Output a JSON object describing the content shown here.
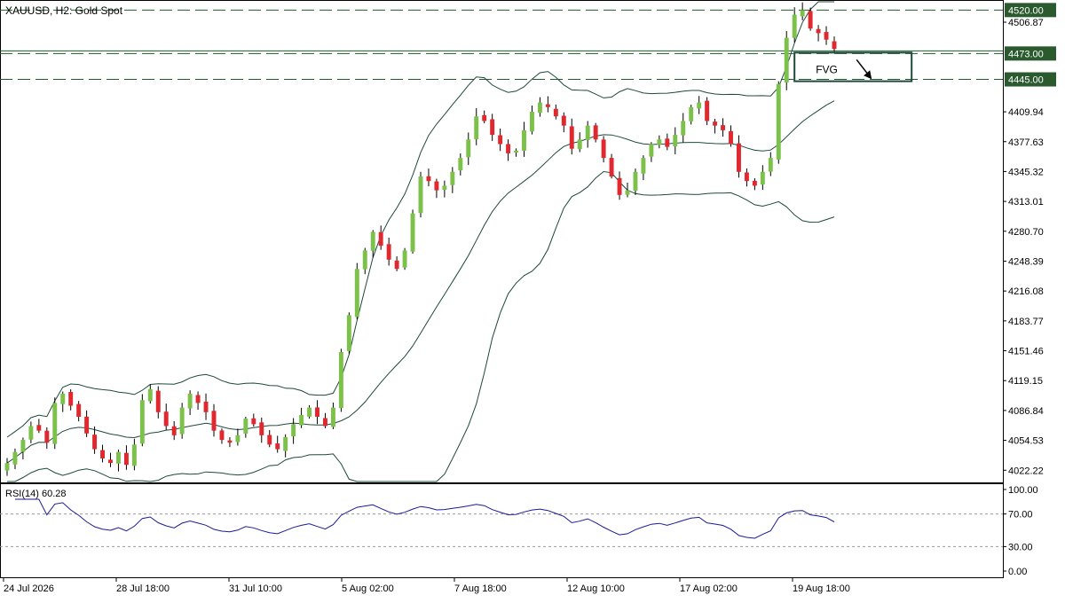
{
  "header": {
    "symbol_label": "XAUUSD, H2:  Gold Spot"
  },
  "rsi_panel": {
    "label": "RSI(14) 60.28"
  },
  "colors": {
    "bull": "#7cc24a",
    "bear": "#e0282e",
    "band": "#1d4a3a",
    "rsi_line": "#1a1a9a",
    "grid_dash": "#1f5a2a",
    "price_tag_bg": "#2a5a2e",
    "price_tag_text": "#ffffff",
    "fvg_box": "#1d4a3a"
  },
  "chart_data": [
    {
      "type": "candlestick",
      "title": "XAUUSD, H2:  Gold Spot",
      "y_ticks": [
        "4506.87",
        "4409.94",
        "4377.63",
        "4345.32",
        "4313.01",
        "4280.70",
        "4248.39",
        "4216.08",
        "4183.77",
        "4151.46",
        "4119.15",
        "4086.84",
        "4054.53",
        "4022.22"
      ],
      "x_ticks": [
        "24 Jul 2026",
        "28 Jul 18:00",
        "31 Jul 10:00",
        "5 Aug 02:00",
        "7 Aug 18:00",
        "12 Aug 10:00",
        "17 Aug 02:00",
        "19 Aug 18:00"
      ],
      "ylim": [
        4010,
        4528
      ],
      "levels": [
        {
          "value": 4520.0,
          "label": "4520.00"
        },
        {
          "value": 4473.0,
          "label": "4473.00"
        },
        {
          "value": 4445.0,
          "label": "4445.00"
        }
      ],
      "annotations": [
        {
          "text": "FVG",
          "type": "box",
          "price_top": 4474,
          "price_bottom": 4443
        },
        {
          "type": "arrow",
          "direction": "down"
        }
      ],
      "indicators": [
        "Bollinger Bands"
      ],
      "close_path": [
        4030,
        4042,
        4055,
        4070,
        4065,
        4052,
        4095,
        4105,
        4092,
        4080,
        4062,
        4045,
        4035,
        4030,
        4042,
        4028,
        4050,
        4098,
        4110,
        4085,
        4070,
        4060,
        4090,
        4105,
        4095,
        4085,
        4065,
        4055,
        4052,
        4060,
        4078,
        4072,
        4060,
        4050,
        4045,
        4058,
        4072,
        4082,
        4090,
        4080,
        4070,
        4090,
        4150,
        4190,
        4240,
        4260,
        4280,
        4265,
        4250,
        4240,
        4260,
        4300,
        4340,
        4335,
        4325,
        4330,
        4345,
        4360,
        4380,
        4405,
        4400,
        4385,
        4375,
        4365,
        4368,
        4390,
        4410,
        4420,
        4415,
        4405,
        4395,
        4370,
        4380,
        4395,
        4380,
        4360,
        4340,
        4320,
        4325,
        4345,
        4360,
        4375,
        4380,
        4372,
        4385,
        4400,
        4415,
        4420,
        4400,
        4395,
        4390,
        4375,
        4345,
        4335,
        4330,
        4345,
        4360,
        4440,
        4490,
        4515,
        4520,
        4500,
        4495,
        4488,
        4478
      ]
    },
    {
      "type": "line",
      "title": "RSI(14) 60.28",
      "indicator": "RSI(14)",
      "value": 60.28,
      "y_ticks": [
        "100.00",
        "70.00",
        "30.00",
        "0.00"
      ],
      "levels": [
        70,
        30
      ],
      "ylim": [
        0,
        100
      ]
    }
  ]
}
